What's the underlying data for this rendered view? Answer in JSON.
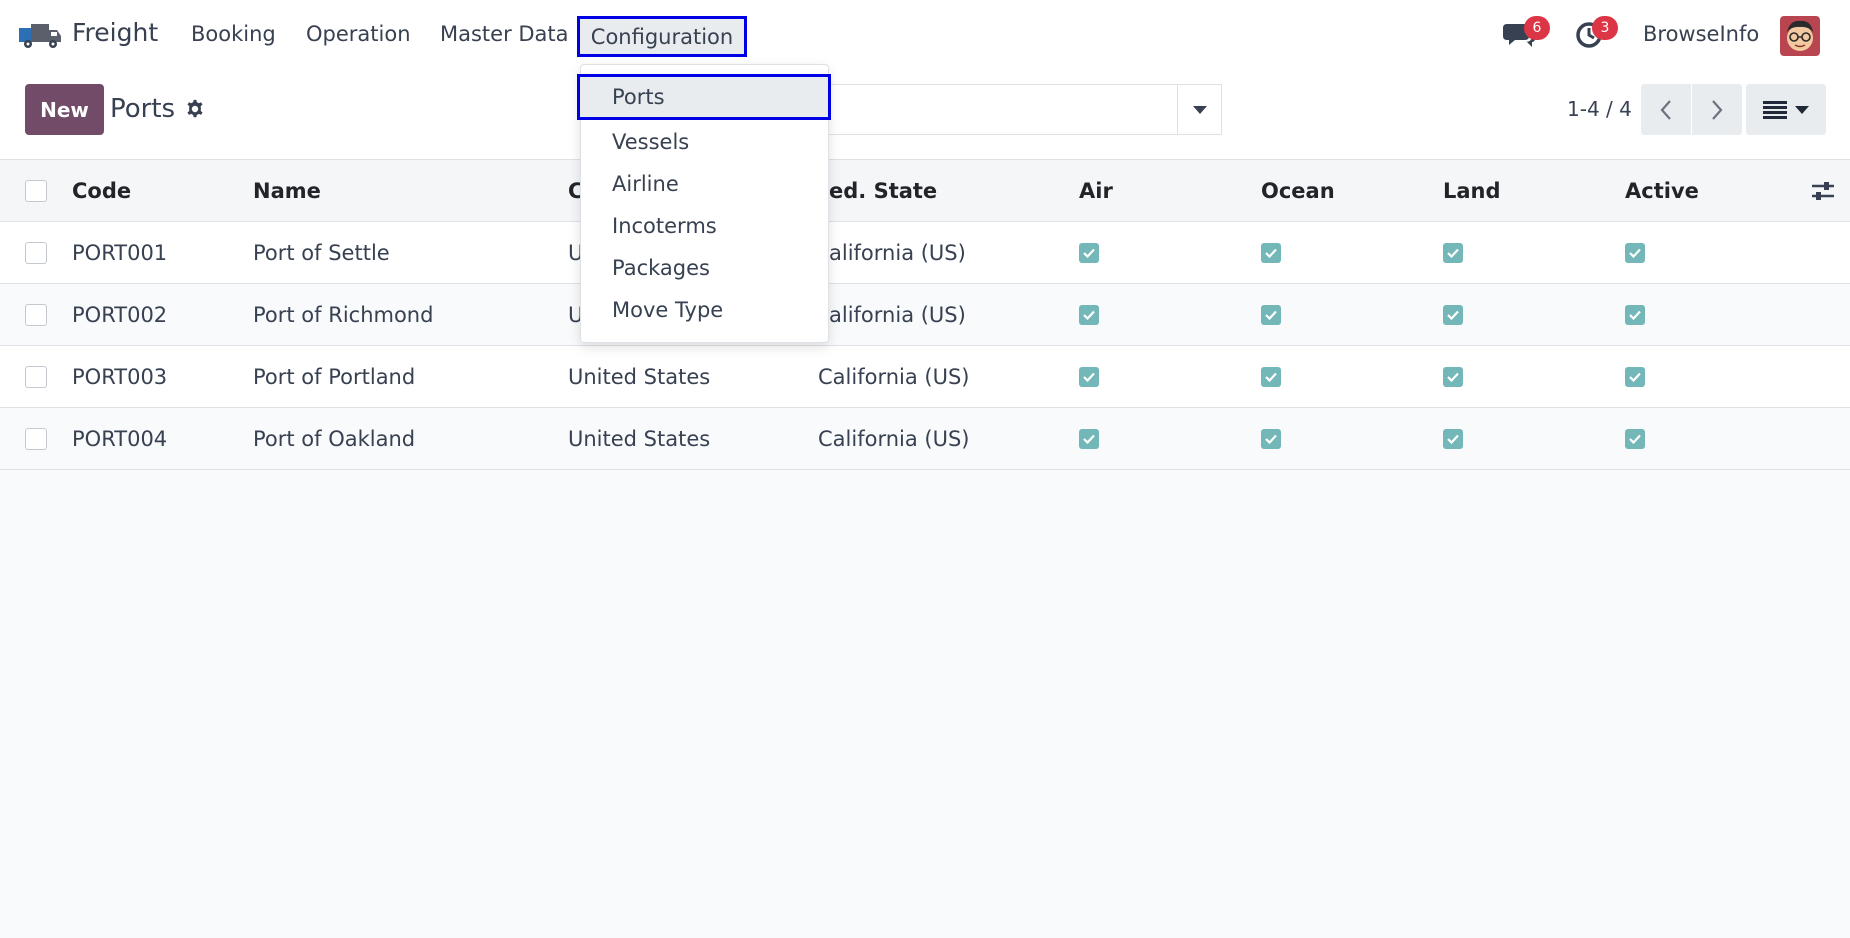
{
  "navbar": {
    "brand": "Freight",
    "menu": [
      "Booking",
      "Operation",
      "Master Data"
    ],
    "active_menu": "Configuration",
    "messages_count": "6",
    "activities_count": "3",
    "user_name": "BrowseInfo"
  },
  "control_panel": {
    "new_label": "New",
    "title": "Ports",
    "pager": "1-4 / 4"
  },
  "dropdown": {
    "active_item": "Ports",
    "items": [
      "Vessels",
      "Airline",
      "Incoterms",
      "Packages",
      "Move Type"
    ]
  },
  "table": {
    "headers": [
      "Code",
      "Name",
      "C",
      "ed. State",
      "Air",
      "Ocean",
      "Land",
      "Active"
    ],
    "rows": [
      {
        "code": "PORT001",
        "name": "Port of Settle",
        "country": "U",
        "state": "alifornia (US)",
        "air": true,
        "ocean": true,
        "land": true,
        "active": true
      },
      {
        "code": "PORT002",
        "name": "Port of Richmond",
        "country": "U",
        "state": "alifornia (US)",
        "air": true,
        "ocean": true,
        "land": true,
        "active": true
      },
      {
        "code": "PORT003",
        "name": "Port of Portland",
        "country": "United States",
        "state": "California (US)",
        "air": true,
        "ocean": true,
        "land": true,
        "active": true
      },
      {
        "code": "PORT004",
        "name": "Port of Oakland",
        "country": "United States",
        "state": "California (US)",
        "air": true,
        "ocean": true,
        "land": true,
        "active": true
      }
    ]
  },
  "colors": {
    "primary": "#714b67",
    "highlight": "#0000e6",
    "checkbox": "#73b7b8",
    "badge": "#dc3545"
  }
}
